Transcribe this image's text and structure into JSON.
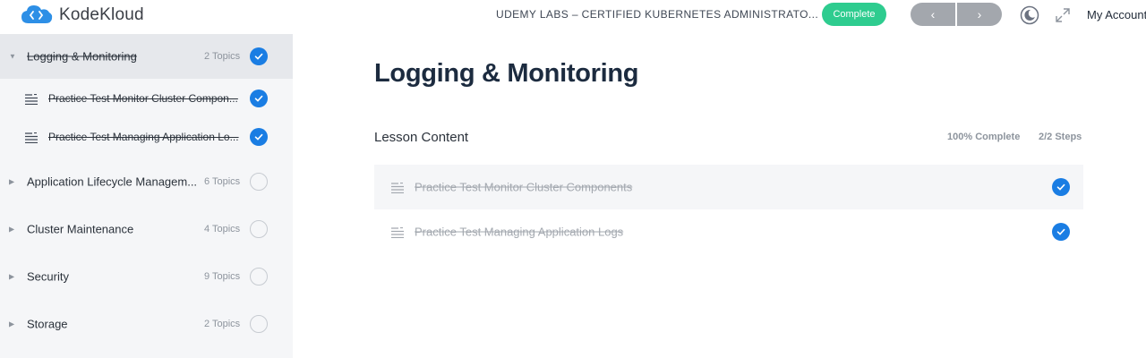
{
  "header": {
    "brand": "KodeKloud",
    "course_title": "UDEMY LABS – CERTIFIED KUBERNETES ADMINISTRATO...",
    "complete_label": "Complete",
    "prev_glyph": "‹",
    "next_glyph": "›",
    "account_label": "My Account"
  },
  "sidebar": {
    "sections": [
      {
        "title": "Logging & Monitoring",
        "topics": "2 Topics",
        "completed": true,
        "expanded": true,
        "lessons": [
          {
            "title": "Practice Test Monitor Cluster Compon...",
            "completed": true
          },
          {
            "title": "Practice Test Managing Application Lo...",
            "completed": true
          }
        ]
      },
      {
        "title": "Application Lifecycle Managem...",
        "topics": "6 Topics",
        "completed": false
      },
      {
        "title": "Cluster Maintenance",
        "topics": "4 Topics",
        "completed": false
      },
      {
        "title": "Security",
        "topics": "9 Topics",
        "completed": false
      },
      {
        "title": "Storage",
        "topics": "2 Topics",
        "completed": false
      }
    ]
  },
  "main": {
    "title": "Logging & Monitoring",
    "lesson_content_label": "Lesson Content",
    "progress_text": "100% Complete",
    "steps_text": "2/2 Steps",
    "lessons": [
      {
        "title": "Practice Test Monitor Cluster Components",
        "completed": true
      },
      {
        "title": "Practice Test Managing Application Logs",
        "completed": true
      }
    ]
  },
  "colors": {
    "accent": "#1a7de3",
    "complete_green": "#2ecc8f",
    "sidebar_bg": "#f5f6f8",
    "active_row": "#e6e8ec",
    "nav_gray": "#a3a7ad",
    "title_navy": "#1c2b3f"
  },
  "icons": {
    "logo": "kodekloud-cloud-icon",
    "dark_mode": "moon-icon",
    "fullscreen": "expand-icon",
    "lesson": "lesson-lines-icon",
    "done": "check-circle-icon",
    "todo": "empty-circle-icon",
    "caret": "caret-right-icon"
  }
}
